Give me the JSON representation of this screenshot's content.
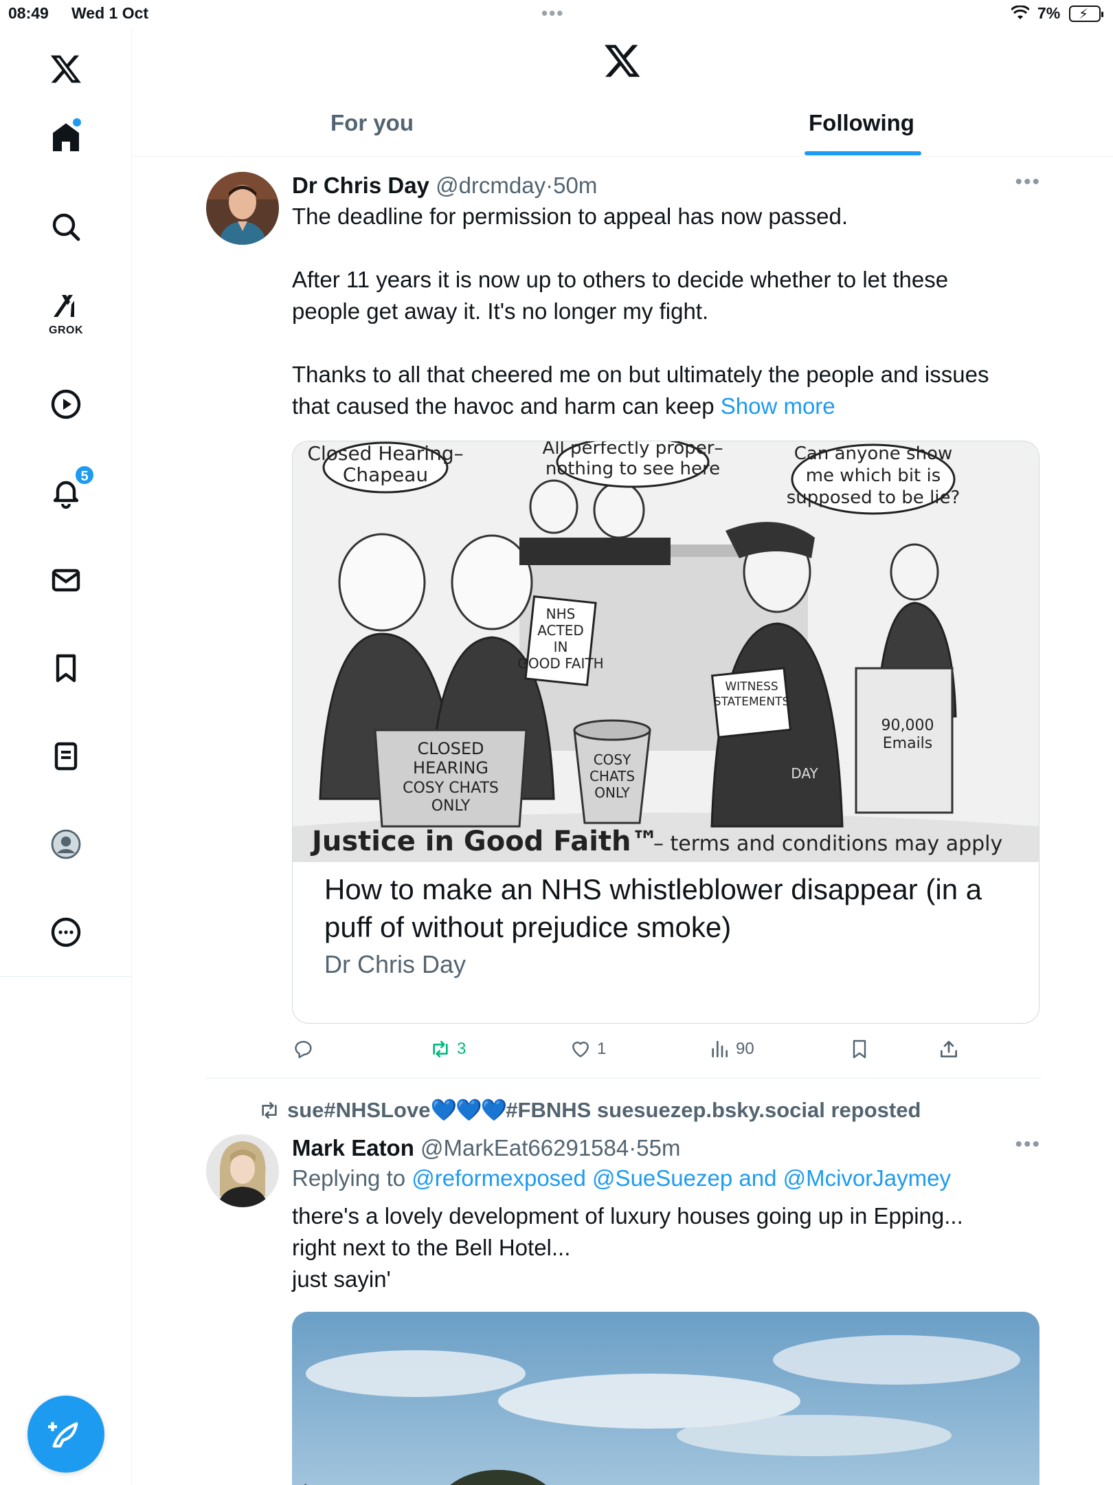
{
  "status_bar": {
    "time": "08:49",
    "date": "Wed 1 Oct",
    "battery": "7%"
  },
  "sidebar": {
    "items": [
      {
        "name": "home",
        "icon": "home-icon"
      },
      {
        "name": "search",
        "icon": "search-icon"
      },
      {
        "name": "grok",
        "icon": "grok-icon",
        "label": "GROK"
      },
      {
        "name": "video",
        "icon": "play-icon"
      },
      {
        "name": "notifications",
        "icon": "bell-icon",
        "badge": "5"
      },
      {
        "name": "messages",
        "icon": "mail-icon"
      },
      {
        "name": "bookmarks",
        "icon": "bookmark-icon"
      },
      {
        "name": "lists",
        "icon": "list-icon"
      },
      {
        "name": "profile",
        "icon": "profile-icon"
      },
      {
        "name": "more",
        "icon": "more-circle-icon"
      }
    ]
  },
  "tabs": {
    "for_you": "For you",
    "following": "Following",
    "active": "Following"
  },
  "tweet1": {
    "name": "Dr Chris Day",
    "handle": "@drcmday",
    "dot": "·",
    "time": "50m",
    "line1": "The deadline for permission to appeal has now passed.",
    "line2": "After 11 years it is now up to others to decide whether to let these",
    "line3": "people get away it. It's no longer my fight.",
    "line4": "Thanks to all that cheered me on but ultimately the people and issues",
    "line5": "that caused the havoc and harm can keep",
    "show_more": "Show more",
    "card": {
      "image_caption": "Justice in Good Faith™ – terms and conditions may apply",
      "bubble1": "Closed Hearing– Chapeau",
      "bubble2": "All perfectly proper– nothing to see here",
      "bubble3": "Can anyone show me which bit is supposed to be lie?",
      "sign1": "NHS ACTED IN GOOD FAITH",
      "sign2": "CLOSED HEARING COSY CHATS ONLY",
      "sign3": "COSY CHATS ONLY",
      "sign4": "WITNESS STATEMENTS",
      "sign5": "90,000 Emails",
      "sign6": "DAY",
      "title": "How to make an NHS whistleblower disappear (in a puff of without prejudice smoke)",
      "source": "Dr Chris Day"
    },
    "actions": {
      "replies": "",
      "reposts": "3",
      "likes": "1",
      "views": "90"
    }
  },
  "tweet2": {
    "reposted_by_prefix": "sue#NHSLove",
    "reposted_by_hearts": "💙💙💙",
    "reposted_by_suffix": "#FBNHS suesuezep.bsky.social reposted",
    "name": "Mark Eaton",
    "handle": "@MarkEat66291584",
    "dot": "·",
    "time": "55m",
    "replying_prefix": "Replying to",
    "replying_to": "@reformexposed @SueSuezep and @McivorJaymey",
    "line1": "there's a lovely development of luxury houses going up in Epping...",
    "line2": "right next to the Bell Hotel...",
    "line3": "just sayin'"
  },
  "colors": {
    "accent": "#1d9bf0",
    "retweet": "#00ba7c",
    "secondary_text": "#536471"
  }
}
